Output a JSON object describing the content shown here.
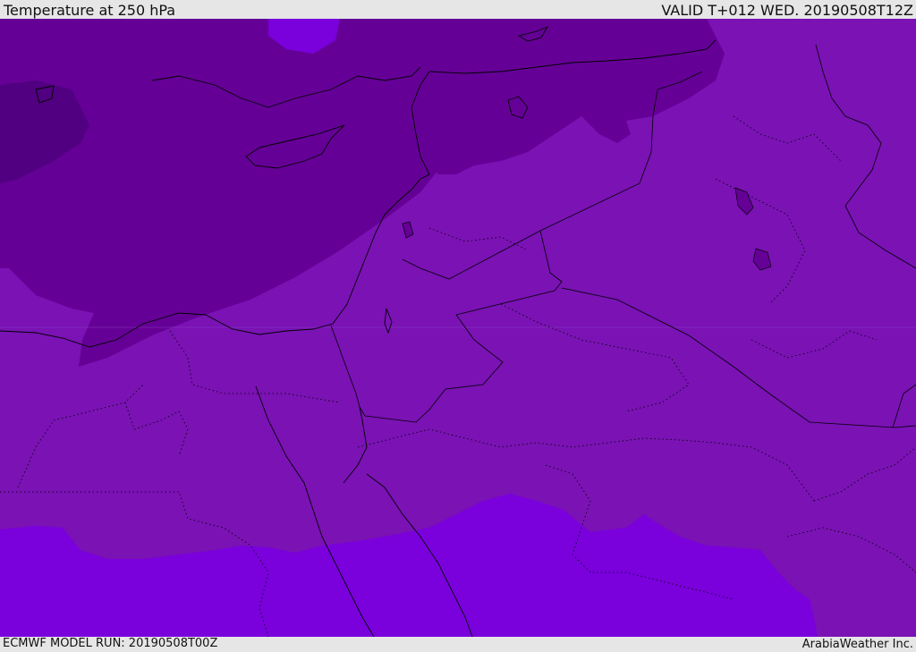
{
  "header": {
    "title": "Temperature at 250 hPa",
    "valid": "VALID T+012 WED. 20190508T12Z"
  },
  "footer": {
    "model_run": "ECMWF MODEL RUN: 20190508T00Z",
    "credit": "ArabiaWeather Inc."
  },
  "colors": {
    "band_coldest": "#500080",
    "band_cold": "#650096",
    "band_mid": "#7a12b4",
    "band_warm": "#7a00dc",
    "boundary": "#000000"
  }
}
